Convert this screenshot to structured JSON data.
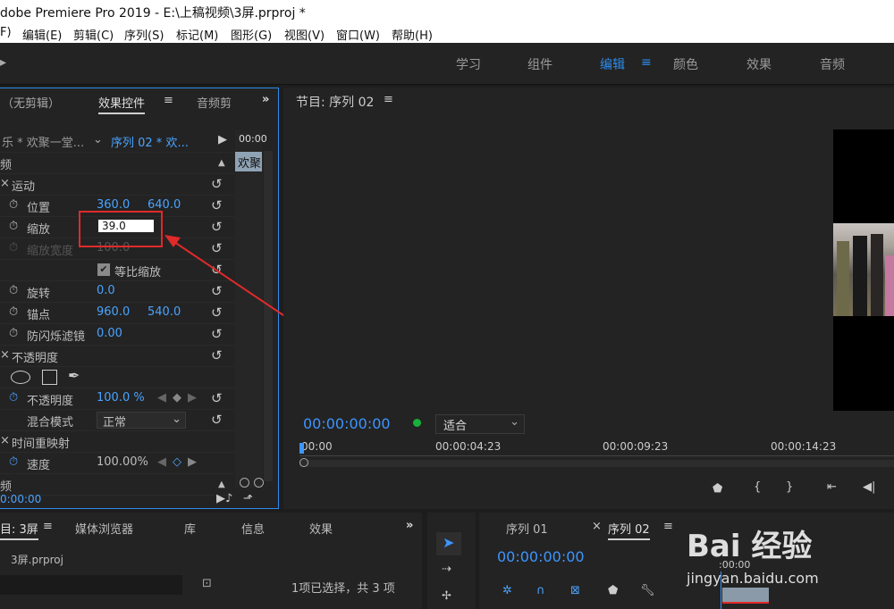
{
  "window": {
    "title": "dobe Premiere Pro 2019 - E:\\上稿视频\\3屏.prproj *"
  },
  "menu": [
    "F)",
    "编辑(E)",
    "剪辑(C)",
    "序列(S)",
    "标记(M)",
    "图形(G)",
    "视图(V)",
    "窗口(W)",
    "帮助(H)"
  ],
  "workspaces": [
    "学习",
    "组件",
    "编辑",
    "颜色",
    "效果",
    "音频"
  ],
  "effect_controls": {
    "tab_noclip": "（无剪辑）",
    "tab_active": "效果控件",
    "tab_audio": "音频剪",
    "clip_master": "乐 * 欢聚一堂...",
    "clip_seq": "序列 02 * 欢...",
    "timecode_head": "00:00",
    "clip_bar": "欢聚",
    "video_header": "频",
    "motion": "运动",
    "position_label": "位置",
    "position_x": "360.0",
    "position_y": "640.0",
    "scale_label": "缩放",
    "scale_value": "39.0",
    "scale_width_label": "缩放宽度",
    "scale_width_value": "100.0",
    "uniform_label": "等比缩放",
    "rotation_label": "旋转",
    "rotation_value": "0.0",
    "anchor_label": "锚点",
    "anchor_x": "960.0",
    "anchor_y": "540.0",
    "flicker_label": "防闪烁滤镜",
    "flicker_value": "0.00",
    "opacity_group": "不透明度",
    "opacity_label": "不透明度",
    "opacity_value": "100.0 %",
    "blend_label": "混合模式",
    "blend_value": "正常",
    "time_remap": "时间重映射",
    "speed_label": "速度",
    "speed_value": "100.00%",
    "audio_header": "频",
    "footer_time": "0:00:00"
  },
  "program_monitor": {
    "title": "节目: 序列 02",
    "timecode": "00:00:00:00",
    "fit": "适合",
    "ruler": [
      "00:00",
      "00:00:04:23",
      "00:00:09:23",
      "00:00:14:23"
    ]
  },
  "project": {
    "tabs": [
      "目: 3屏",
      "媒体浏览器",
      "库",
      "信息",
      "效果"
    ],
    "file": "3屏.prproj",
    "selection": "1项已选择，共 3 项"
  },
  "timeline": {
    "tab1": "序列 01",
    "tab2": "序列 02",
    "timecode": "00:00:00:00",
    "ruler_start": ":00:00",
    "watermark": "Bai 经验",
    "watermark_url": "jingyan.baidu.com"
  }
}
